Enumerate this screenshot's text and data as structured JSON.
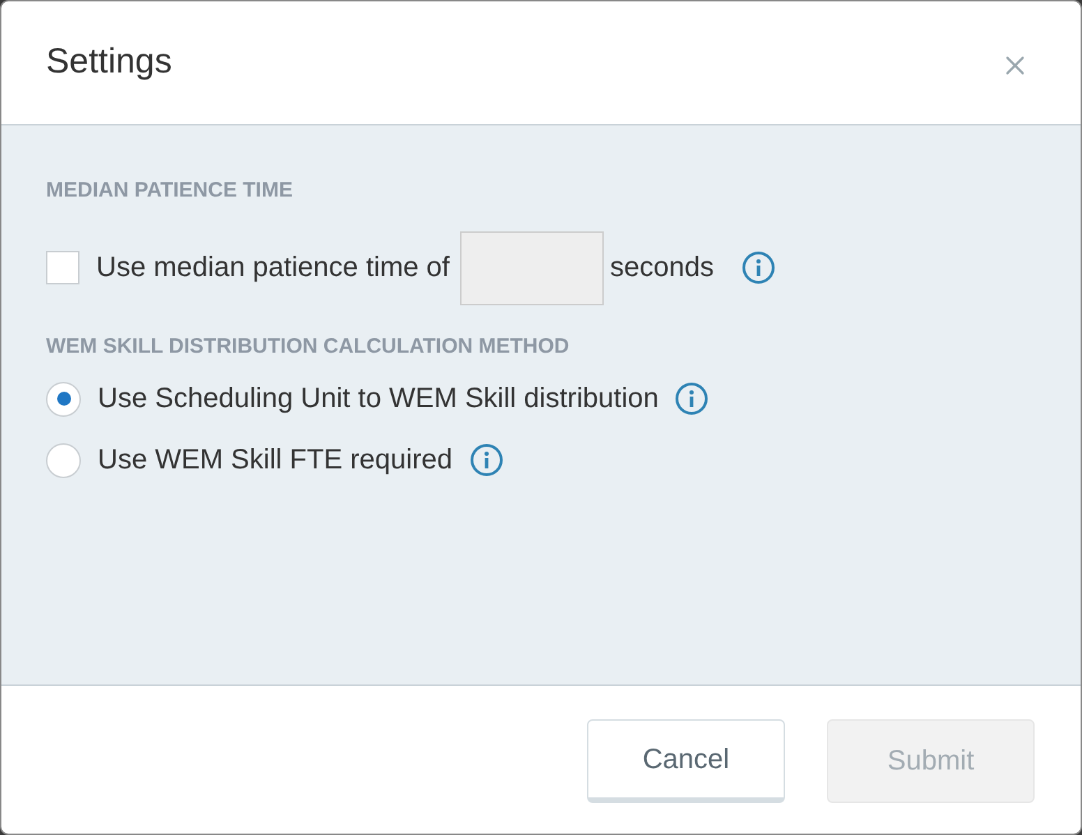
{
  "dialog": {
    "title": "Settings"
  },
  "patience": {
    "heading": "MEDIAN PATIENCE TIME",
    "option": {
      "label": "Use median patience time of",
      "checked": false,
      "suffix": "seconds"
    }
  },
  "distribution": {
    "heading": "WEM SKILL DISTRIBUTION CALCULATION METHOD",
    "options": [
      {
        "label": "Use Scheduling Unit to WEM Skill distribution",
        "selected": true
      },
      {
        "label": "Use WEM Skill FTE required",
        "selected": false
      }
    ]
  },
  "buttons": [
    {
      "label": "Cancel",
      "disabled": false
    },
    {
      "label": "Submit",
      "disabled": true
    }
  ]
}
